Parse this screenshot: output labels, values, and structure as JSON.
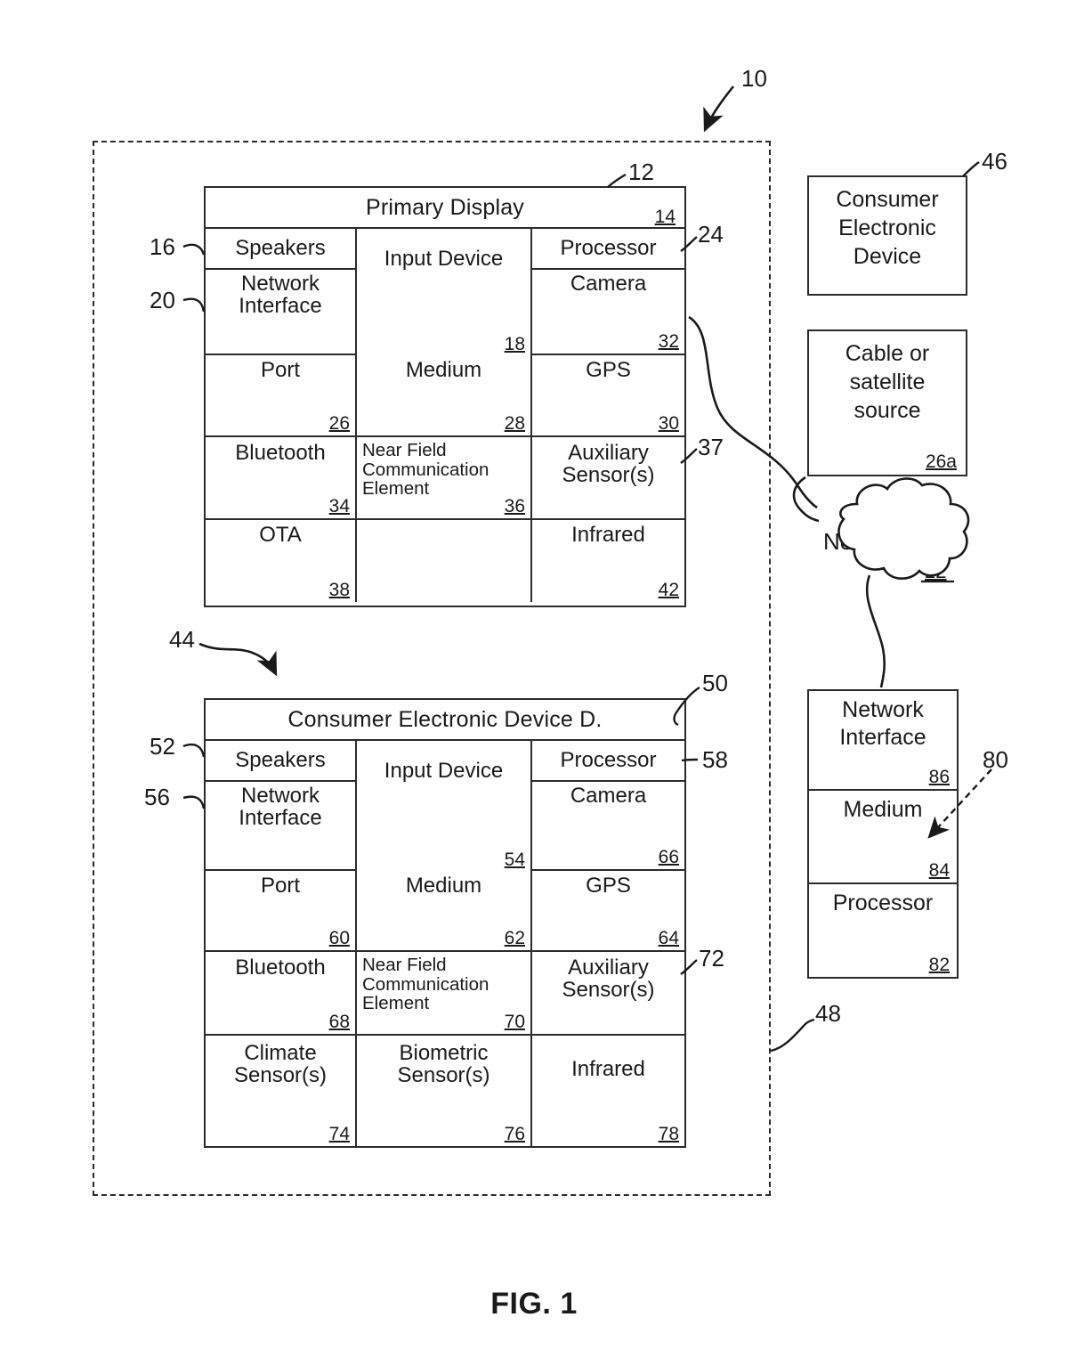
{
  "figure": {
    "caption": "FIG. 1",
    "system_ref": "10"
  },
  "primary_device": {
    "ref": "12",
    "title": "Primary Display",
    "title_num": "14",
    "left_refs": [
      {
        "label": "16"
      },
      {
        "label": "20"
      }
    ],
    "right_refs": [
      {
        "label": "24"
      },
      {
        "label": "37"
      }
    ],
    "cells": [
      {
        "name": "speakers",
        "label": "Speakers",
        "num": ""
      },
      {
        "name": "input-device",
        "label": "Input Device",
        "num": "18"
      },
      {
        "name": "processor",
        "label": "Processor",
        "num": ""
      },
      {
        "name": "network-interface",
        "label": "Network\nInterface",
        "num": ""
      },
      {
        "name": "camera",
        "label": "Camera",
        "num": "32"
      },
      {
        "name": "port",
        "label": "Port",
        "num": "26"
      },
      {
        "name": "medium",
        "label": "Medium",
        "num": "28"
      },
      {
        "name": "gps",
        "label": "GPS",
        "num": "30"
      },
      {
        "name": "bluetooth",
        "label": "Bluetooth",
        "num": "34"
      },
      {
        "name": "nfc",
        "label": "Near Field\nCommunication\nElement",
        "num": "36"
      },
      {
        "name": "auxiliary-sensors",
        "label": "Auxiliary\nSensor(s)",
        "num": ""
      },
      {
        "name": "ota",
        "label": "OTA",
        "num": "38"
      },
      {
        "name": "blank",
        "label": "",
        "num": ""
      },
      {
        "name": "infrared",
        "label": "Infrared",
        "num": "42"
      }
    ]
  },
  "consumer_device": {
    "ref_block": "44",
    "ref_title": "50",
    "title": "Consumer Electronic Device D.",
    "left_refs": [
      {
        "label": "52"
      },
      {
        "label": "56"
      }
    ],
    "right_refs": [
      {
        "label": "58"
      },
      {
        "label": "72"
      }
    ],
    "cells": [
      {
        "name": "speakers",
        "label": "Speakers",
        "num": ""
      },
      {
        "name": "input-device",
        "label": "Input Device",
        "num": "54"
      },
      {
        "name": "processor",
        "label": "Processor",
        "num": ""
      },
      {
        "name": "network-interface",
        "label": "Network\nInterface",
        "num": ""
      },
      {
        "name": "camera",
        "label": "Camera",
        "num": "66"
      },
      {
        "name": "port",
        "label": "Port",
        "num": "60"
      },
      {
        "name": "medium",
        "label": "Medium",
        "num": "62"
      },
      {
        "name": "gps",
        "label": "GPS",
        "num": "64"
      },
      {
        "name": "bluetooth",
        "label": "Bluetooth",
        "num": "68"
      },
      {
        "name": "nfc",
        "label": "Near Field\nCommunication\nElement",
        "num": "70"
      },
      {
        "name": "auxiliary-sensors",
        "label": "Auxiliary\nSensor(s)",
        "num": ""
      },
      {
        "name": "climate-sensors",
        "label": "Climate\nSensor(s)",
        "num": "74"
      },
      {
        "name": "biometric-sensors",
        "label": "Biometric\nSensor(s)",
        "num": "76"
      },
      {
        "name": "infrared",
        "label": "Infrared",
        "num": "78"
      }
    ]
  },
  "consumer_electronic_device_box": {
    "ref": "46",
    "lines": [
      "Consumer",
      "Electronic",
      "Device"
    ]
  },
  "cable_satellite_box": {
    "lines": [
      "Cable or",
      "satellite",
      "source"
    ],
    "num": "26a"
  },
  "network_cloud": {
    "label": "Network",
    "num": "22"
  },
  "server": {
    "ref": "80",
    "rows": [
      {
        "name": "network-interface",
        "lines": [
          "Network",
          "Interface"
        ],
        "num": "86"
      },
      {
        "name": "medium",
        "lines": [
          "Medium"
        ],
        "num": "84"
      },
      {
        "name": "processor",
        "lines": [
          "Processor"
        ],
        "num": "82"
      }
    ]
  },
  "boundary": {
    "ref": "48"
  }
}
